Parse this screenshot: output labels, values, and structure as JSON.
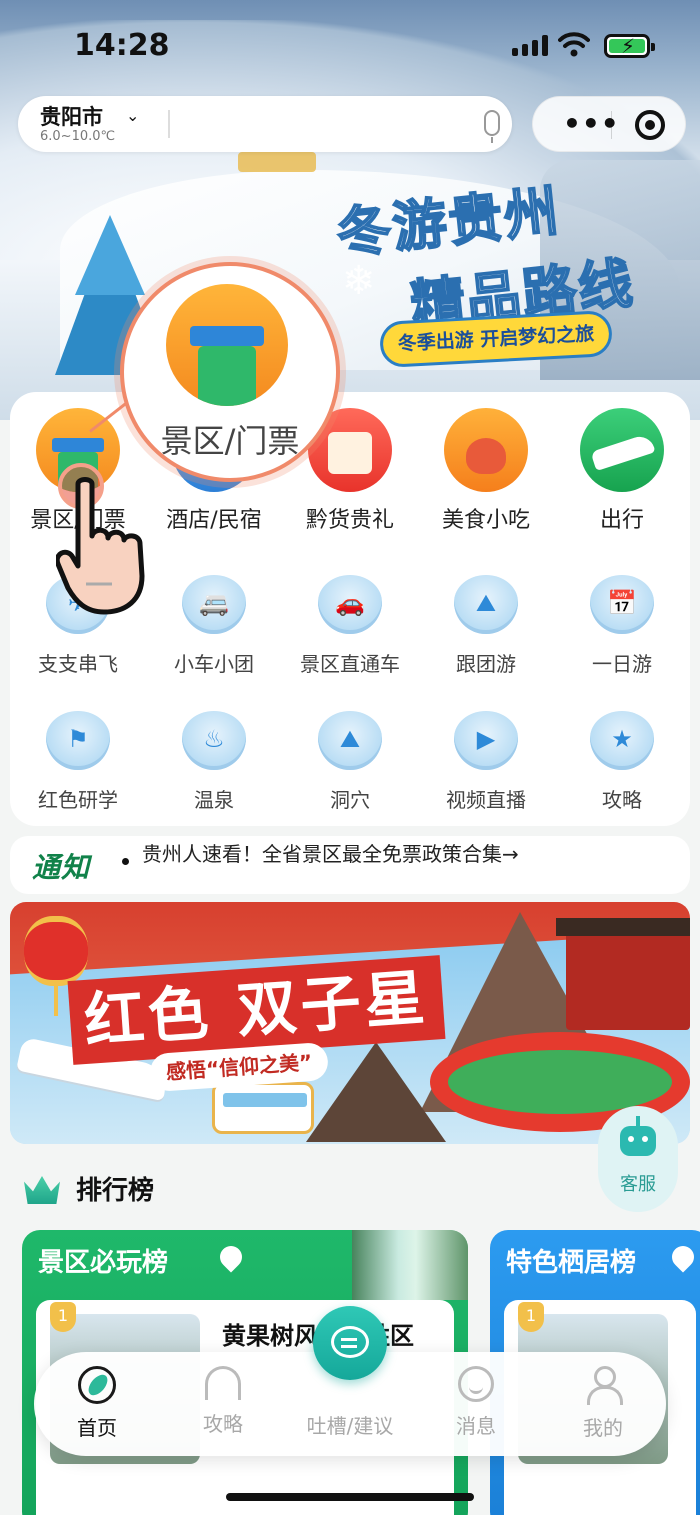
{
  "status_bar": {
    "time": "14:28"
  },
  "search": {
    "city": "贵阳市",
    "weather": "6.0~10.0℃"
  },
  "hero": {
    "title_line1": "冬游贵州",
    "title_line2": "精品路线",
    "ribbon": "冬季出游 开启梦幻之旅"
  },
  "categories": {
    "main": [
      {
        "label": "景区/门票"
      },
      {
        "label": "酒店/民宿"
      },
      {
        "label": "黔货贵礼"
      },
      {
        "label": "美食小吃"
      },
      {
        "label": "出行"
      }
    ],
    "row2": [
      {
        "label": "支支串飞",
        "glyph": "✈"
      },
      {
        "label": "小车小团",
        "glyph": "🚐"
      },
      {
        "label": "景区直通车",
        "glyph": "🚗"
      },
      {
        "label": "跟团游",
        "glyph": "⛰"
      },
      {
        "label": "一日游",
        "glyph": "📅"
      }
    ],
    "row3": [
      {
        "label": "红色研学",
        "glyph": "⚑"
      },
      {
        "label": "温泉",
        "glyph": "♨"
      },
      {
        "label": "洞穴",
        "glyph": "⛰"
      },
      {
        "label": "视频直播",
        "glyph": "▶"
      },
      {
        "label": "攻略",
        "glyph": "★"
      }
    ]
  },
  "zoom": {
    "label": "景区/门票"
  },
  "notice": {
    "tag": "通知",
    "text": "贵州人速看！全省景区最全免票政策合集→"
  },
  "promo": {
    "headline": "红色 双子星",
    "subline": "感悟“信仰之美”"
  },
  "service": {
    "label": "客服"
  },
  "ranking": {
    "title": "排行榜",
    "cards": [
      {
        "title": "景区必玩榜",
        "rank": "1",
        "item": "黄果树风景名胜区"
      },
      {
        "title": "特色栖居榜",
        "rank": "1"
      }
    ]
  },
  "tabbar": {
    "home": "首页",
    "guide": "攻略",
    "feedback": "吐槽/建议",
    "messages": "消息",
    "me": "我的"
  },
  "colors": {
    "brand_green": "#13a35a",
    "accent_teal": "#15a89a",
    "promo_red": "#d8302a",
    "rank_blue": "#1a7fd6"
  },
  "icons": [
    "signal-icon",
    "wifi-icon",
    "battery-icon",
    "chevron-down-icon",
    "microphone-icon",
    "more-icon",
    "target-icon",
    "crown-icon",
    "pin-icon",
    "robot-icon",
    "chat-bubble-icon"
  ]
}
